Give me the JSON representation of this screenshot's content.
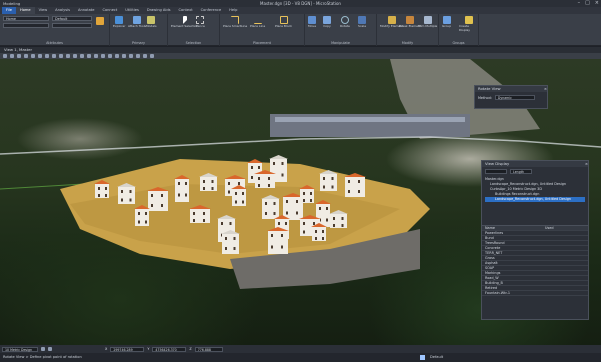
{
  "window": {
    "title": "Master.dgn [3D - V8 DGN] - MicroStation",
    "app_label": "Modeling"
  },
  "menu_tabs": [
    "File",
    "Home",
    "View",
    "Analysis",
    "Annotate",
    "Connect",
    "Utilities",
    "Drawing Aids",
    "Context",
    "Conference",
    "Help"
  ],
  "ribbon": {
    "attributes": {
      "level": "Home",
      "style": "Default",
      "label": "Attributes"
    },
    "primary": {
      "label": "Primary",
      "buttons": [
        "Explorer",
        "Attach Tools",
        "Models",
        "Levels"
      ]
    },
    "selection": {
      "label": "Selection",
      "buttons": [
        "Element Selection",
        "Fence"
      ]
    },
    "placement": {
      "label": "Placement",
      "buttons": [
        "Place SmartLine",
        "Place Line",
        "Place Block"
      ]
    },
    "manipulate": {
      "label": "Manipulate",
      "buttons": [
        "Move",
        "Copy",
        "Rotate",
        "Scale"
      ]
    },
    "modify": {
      "label": "Modify",
      "buttons": [
        "Modify Element",
        "Break Element",
        "Trim Multiple"
      ]
    },
    "groups": {
      "label": "Groups",
      "buttons": [
        "Group",
        "Create Display"
      ]
    }
  },
  "view": {
    "title": "View 1, Master"
  },
  "rotate_view": {
    "title": "Rotate View",
    "method_label": "Method:",
    "method_value": "Dynamic"
  },
  "view_display": {
    "title": "View Display",
    "filter": "Length",
    "tree": [
      {
        "label": "Master.dgn",
        "indent": 0
      },
      {
        "label": "Landscape_Reconstruct.dgn, Untitled Design",
        "indent": 1
      },
      {
        "label": "CurbsApr_10 Metric Design 3D",
        "indent": 1
      },
      {
        "label": "Buildings Reconstruct.dgn",
        "indent": 2
      },
      {
        "label": "Landscape_Reconstruct.dgn, Untitled Design",
        "indent": 2,
        "selected": true
      }
    ],
    "columns": [
      "Name",
      "Used"
    ],
    "rows": [
      "Powerlines",
      "Bund",
      "TreesRound",
      "Concrete",
      "TERR_NET",
      "Grass",
      "Asphalt",
      "SOAP",
      "Markings",
      "Road_W",
      "Building_B",
      "Retired",
      "Fountain.Wtr-1"
    ]
  },
  "statusbar": {
    "tool_prompt": "Rotate View > Define pivot point of rotation",
    "scale": "10 Metric Design",
    "coord_x": "299746.289",
    "coord_y": "4756426.370",
    "coord_z": "776.888",
    "level": "Default"
  },
  "colors": {
    "accent": "#2a5fae",
    "roof": "#d9672c",
    "wall": "#f0ece4",
    "terrace": "#c9a24a"
  }
}
